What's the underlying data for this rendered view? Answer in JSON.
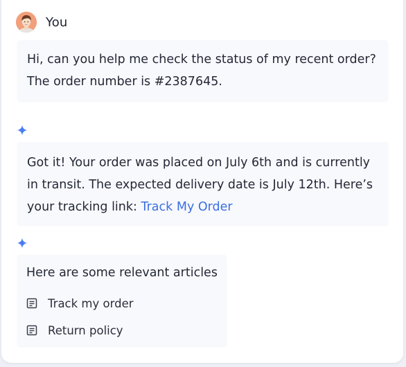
{
  "user": {
    "name": "You"
  },
  "messages": {
    "user_message": "Hi, can you help me check the status of my recent order? The order number is #2387645.",
    "assistant_reply_text": "Got it! Your order was placed on July 6th and is currently in transit. The expected delivery date is July 12th. Here’s your tracking link: ",
    "assistant_reply_link": "Track My Order"
  },
  "articles": {
    "title": "Here are some relevant articles",
    "items": [
      {
        "label": "Track my order",
        "icon": "article-icon"
      },
      {
        "label": "Return policy",
        "icon": "article-icon"
      }
    ]
  },
  "colors": {
    "accent": "#3a6fe0",
    "sparkle": "#4a7df0",
    "bubble_bg": "#f8f9fd",
    "page_bg": "#eef0f6"
  }
}
